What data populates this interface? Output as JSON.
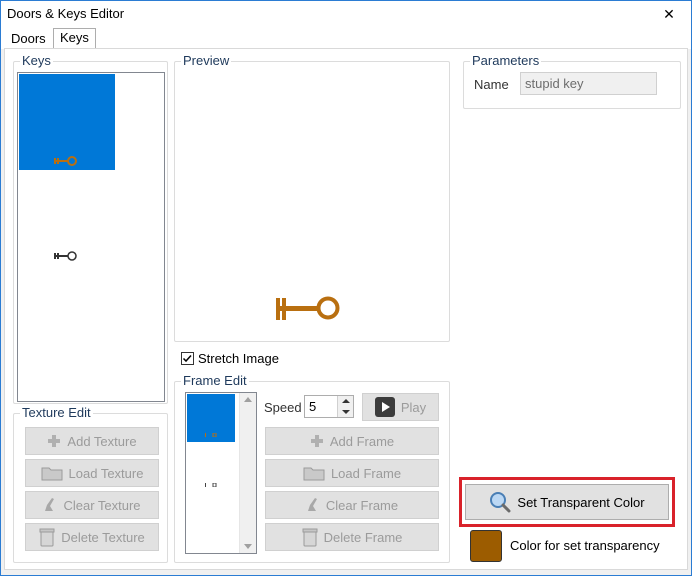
{
  "window": {
    "title": "Doors & Keys Editor",
    "close_glyph": "✕"
  },
  "tabs": [
    {
      "label": "Doors",
      "active": false
    },
    {
      "label": "Keys",
      "active": true
    }
  ],
  "keys_group": {
    "label": "Keys",
    "selected_index": 0
  },
  "texture_edit": {
    "label": "Texture Edit",
    "buttons": [
      "Add Texture",
      "Load Texture",
      "Clear Texture",
      "Delete Texture"
    ]
  },
  "preview": {
    "label": "Preview"
  },
  "stretch_image": {
    "label": "Stretch Image",
    "checked": true
  },
  "frame_edit": {
    "label": "Frame Edit",
    "speed_label": "Speed",
    "speed_value": "5",
    "play_label": "Play",
    "buttons": [
      "Add Frame",
      "Load Frame",
      "Clear Frame",
      "Delete Frame"
    ]
  },
  "parameters": {
    "label": "Parameters",
    "name_label": "Name",
    "name_value": "stupid key"
  },
  "transparent": {
    "button_label": "Set Transparent Color",
    "swatch_label": "Color for set transparency",
    "swatch_color": "#9c5c00",
    "highlight_color": "#d9222a"
  },
  "colors": {
    "selection": "#0078d7",
    "key_sprite": "#b96f10"
  }
}
